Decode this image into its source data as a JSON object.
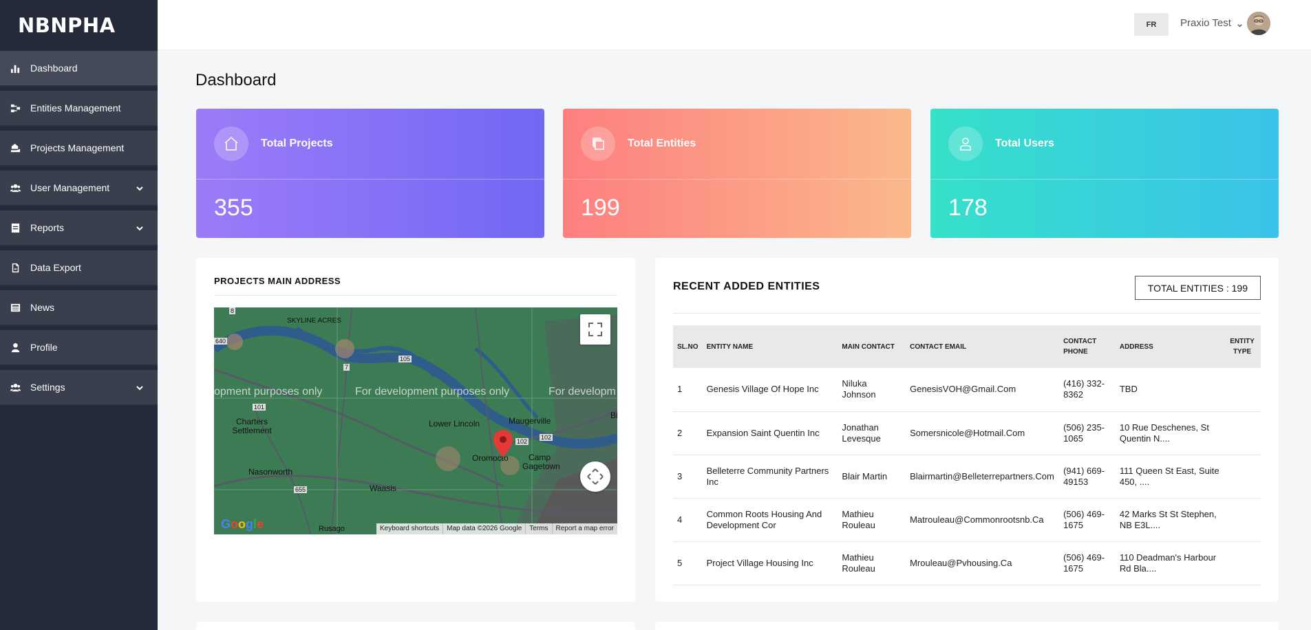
{
  "brand": "NBNPHA",
  "sidebar": {
    "items": [
      {
        "label": "Dashboard",
        "icon": "bar-chart-icon"
      },
      {
        "label": "Entities Management",
        "icon": "network-icon"
      },
      {
        "label": "Projects Management",
        "icon": "hand-house-icon"
      },
      {
        "label": "User Management",
        "icon": "users-icon",
        "has_children": true
      },
      {
        "label": "Reports",
        "icon": "document-icon",
        "has_children": true
      },
      {
        "label": "Data Export",
        "icon": "file-export-icon"
      },
      {
        "label": "News",
        "icon": "newspaper-icon"
      },
      {
        "label": "Profile",
        "icon": "user-icon"
      },
      {
        "label": "Settings",
        "icon": "users-cog-icon",
        "has_children": true
      }
    ]
  },
  "header": {
    "lang": "FR",
    "user_name": "Praxio Test"
  },
  "page_title": "Dashboard",
  "stats": {
    "projects": {
      "label": "Total Projects",
      "value": "355"
    },
    "entities": {
      "label": "Total Entities",
      "value": "199"
    },
    "users": {
      "label": "Total Users",
      "value": "178"
    }
  },
  "map": {
    "title": "PROJECTS MAIN ADDRESS",
    "watermark_1": "opment purposes only",
    "watermark_2": "For development purposes only",
    "watermark_3": "For developm",
    "places": {
      "skyline": "SKYLINE ACRES",
      "charters": "Charters Settlement",
      "nasonworth": "Nasonworth",
      "waasis": "Waasis",
      "lower_lincoln": "Lower Lincoln",
      "maugerville": "Maugerville",
      "oromocto": "Oromocto",
      "camp_gagetown": "Camp Gagetown",
      "rusago": "Rusago",
      "r105": "105",
      "r101": "101",
      "r102a": "102",
      "r102b": "102",
      "r655": "655",
      "r7": "7",
      "r8": "8",
      "r640": "640",
      "b": "Bl"
    },
    "google": "Google",
    "footer": {
      "shortcuts": "Keyboard shortcuts",
      "data": "Map data ©2026 Google",
      "terms": "Terms",
      "report": "Report a map error"
    }
  },
  "entities": {
    "title": "RECENT ADDED ENTITIES",
    "total_label": "TOTAL ENTITIES : 199",
    "columns": [
      "SL.NO",
      "ENTITY NAME",
      "MAIN CONTACT",
      "CONTACT EMAIL",
      "CONTACT PHONE",
      "ADDRESS",
      "ENTITY TYPE"
    ],
    "rows": [
      {
        "no": "1",
        "name": "Genesis Village Of Hope Inc",
        "contact": "Niluka Johnson",
        "email": "GenesisVOH@Gmail.Com",
        "phone": "(416) 332-8362",
        "address": "TBD",
        "type": ""
      },
      {
        "no": "2",
        "name": "Expansion Saint Quentin Inc",
        "contact": "Jonathan Levesque",
        "email": "Somersnicole@Hotmail.Com",
        "phone": "(506) 235-1065",
        "address": "10 Rue Deschenes, St Quentin N....",
        "type": ""
      },
      {
        "no": "3",
        "name": "Belleterre Community Partners Inc",
        "contact": "Blair Martin",
        "email": "Blairmartin@Belleterrepartners.Com",
        "phone": "(941) 669-49153",
        "address": "111 Queen St East, Suite 450, ....",
        "type": ""
      },
      {
        "no": "4",
        "name": "Common Roots Housing And Development Cor",
        "contact": "Mathieu Rouleau",
        "email": "Matrouleau@Commonrootsnb.Ca",
        "phone": "(506) 469-1675",
        "address": "42 Marks St St Stephen, NB E3L....",
        "type": ""
      },
      {
        "no": "5",
        "name": "Project Village Housing Inc",
        "contact": "Mathieu Rouleau",
        "email": "Mrouleau@Pvhousing.Ca",
        "phone": "(506) 469-1675",
        "address": "110 Deadman's Harbour Rd Bla....",
        "type": ""
      }
    ]
  },
  "colors": {
    "sidebar": "#252a3a",
    "projects_start": "#9c7bf8",
    "projects_end": "#7168f4",
    "entities_start": "#fd7f7f",
    "entities_end": "#fbb88c",
    "users_start": "#36e0c9",
    "users_end": "#3ac2ea"
  }
}
